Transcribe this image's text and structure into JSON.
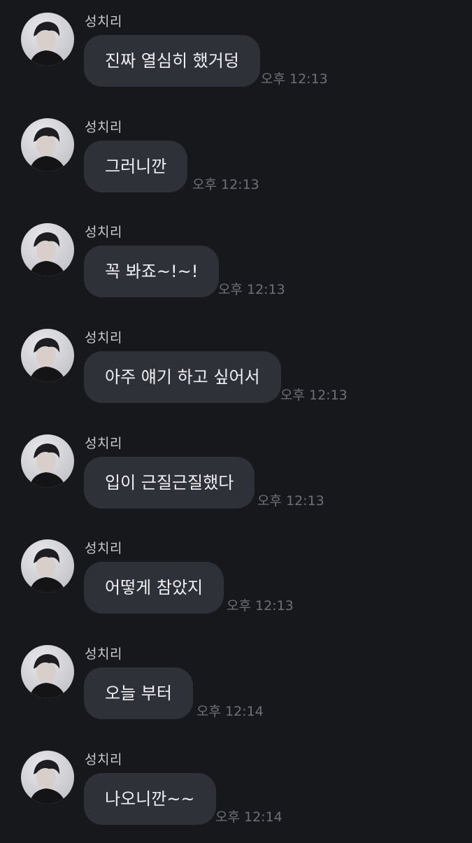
{
  "messages": [
    {
      "sender": "성치리",
      "text": "진짜 열심히 했거덩",
      "time": "오후 12:13"
    },
    {
      "sender": "성치리",
      "text": "그러니깐",
      "time": "오후 12:13"
    },
    {
      "sender": "성치리",
      "text": "꼭 봐죠~!~!",
      "time": "오후 12:13"
    },
    {
      "sender": "성치리",
      "text": "아주 얘기 하고 싶어서",
      "time": "오후 12:13"
    },
    {
      "sender": "성치리",
      "text": "입이 근질근질했다",
      "time": "오후 12:13"
    },
    {
      "sender": "성치리",
      "text": "어떻게 참았지",
      "time": "오후 12:13"
    },
    {
      "sender": "성치리",
      "text": "오늘 부터",
      "time": "오후 12:14"
    },
    {
      "sender": "성치리",
      "text": "나오니깐~~",
      "time": "오후 12:14"
    }
  ],
  "colors": {
    "background": "#17181c",
    "bubble": "#2f3139",
    "message_text": "#f0f0f2",
    "sender_text": "#c9cacd",
    "time_text": "#6e7078"
  },
  "icons": {
    "avatar": "profile-photo"
  }
}
